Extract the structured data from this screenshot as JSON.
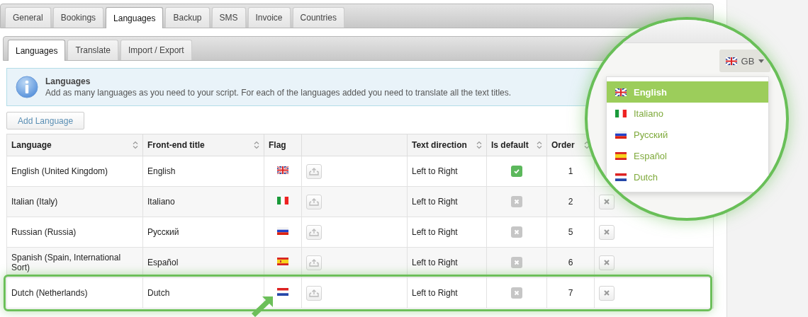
{
  "tabs": [
    {
      "label": "General",
      "selected": false
    },
    {
      "label": "Bookings",
      "selected": false
    },
    {
      "label": "Languages",
      "selected": true
    },
    {
      "label": "Backup",
      "selected": false
    },
    {
      "label": "SMS",
      "selected": false
    },
    {
      "label": "Invoice",
      "selected": false
    },
    {
      "label": "Countries",
      "selected": false
    }
  ],
  "subtabs": [
    {
      "label": "Languages",
      "selected": true
    },
    {
      "label": "Translate",
      "selected": false
    },
    {
      "label": "Import / Export",
      "selected": false
    }
  ],
  "notice": {
    "title": "Languages",
    "text": "Add as many languages as you need to your script. For each of the languages added you need to translate all the text titles."
  },
  "add_button": "Add Language",
  "table": {
    "columns": [
      {
        "label": "Language",
        "sortable": true
      },
      {
        "label": "Front-end title",
        "sortable": true
      },
      {
        "label": "Flag",
        "sortable": false
      },
      {
        "sortable": false
      },
      {
        "label": "Text direction",
        "sortable": true
      },
      {
        "label": "Is default",
        "sortable": true
      },
      {
        "label": "Order",
        "sortable": true
      }
    ],
    "rows": [
      {
        "language": "English (United Kingdom)",
        "title": "English",
        "kind": "gb",
        "direction": "Left to Right",
        "is_default": true,
        "order": "1",
        "deletable": false,
        "highlighted": false
      },
      {
        "language": "Italian (Italy)",
        "title": "Italiano",
        "kind": "it",
        "direction": "Left to Right",
        "is_default": false,
        "order": "2",
        "deletable": true,
        "highlighted": false
      },
      {
        "language": "Russian (Russia)",
        "title": "Русский",
        "kind": "ru",
        "direction": "Left to Right",
        "is_default": false,
        "order": "5",
        "deletable": true,
        "highlighted": false
      },
      {
        "language": "Spanish (Spain, International Sort)",
        "title": "Español",
        "kind": "es",
        "direction": "Left to Right",
        "is_default": false,
        "order": "6",
        "deletable": true,
        "highlighted": false
      },
      {
        "language": "Dutch (Netherlands)",
        "title": "Dutch",
        "kind": "nl",
        "direction": "Left to Right",
        "is_default": false,
        "order": "7",
        "deletable": true,
        "highlighted": true
      }
    ]
  },
  "magnifier": {
    "button": {
      "label": "GB",
      "kind": "gb"
    },
    "menu": [
      {
        "label": "English",
        "kind": "gb",
        "selected": true
      },
      {
        "label": "Italiano",
        "kind": "it",
        "selected": false
      },
      {
        "label": "Русский",
        "kind": "ru",
        "selected": false
      },
      {
        "label": "Español",
        "kind": "es",
        "selected": false
      },
      {
        "label": "Dutch",
        "kind": "nl",
        "selected": false
      }
    ]
  }
}
